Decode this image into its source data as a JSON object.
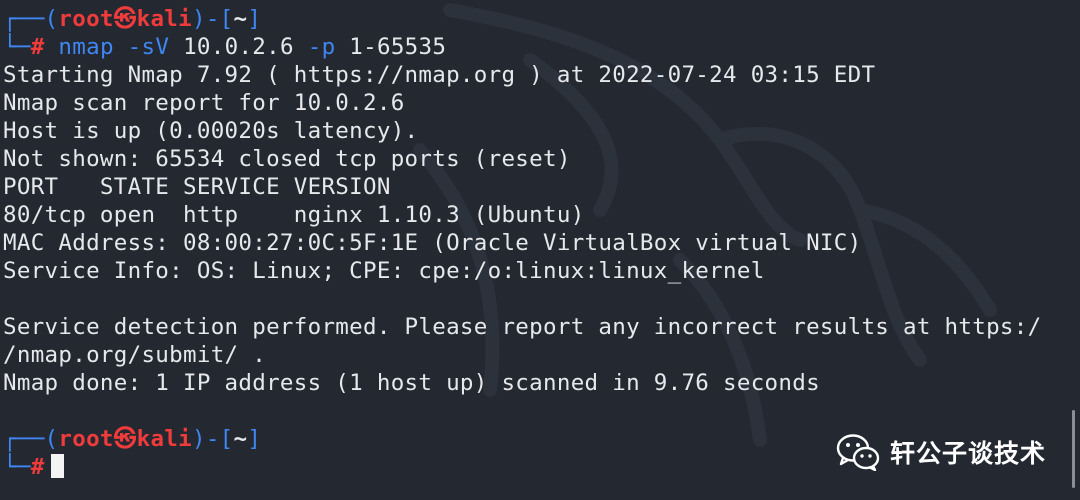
{
  "prompt": {
    "open": "┌──(",
    "user": "root",
    "skull": "㉿",
    "host": "kali",
    "mid": ")-[",
    "dir": "~",
    "close": "]",
    "second": "└─",
    "hash": "#"
  },
  "command": {
    "name": "nmap",
    "flag1": "-sV",
    "target": "10.0.2.6",
    "flag2": "-p",
    "ports": "1-65535"
  },
  "output": [
    "Starting Nmap 7.92 ( https://nmap.org ) at 2022-07-24 03:15 EDT",
    "Nmap scan report for 10.0.2.6",
    "Host is up (0.00020s latency).",
    "Not shown: 65534 closed tcp ports (reset)",
    "PORT   STATE SERVICE VERSION",
    "80/tcp open  http    nginx 1.10.3 (Ubuntu)",
    "MAC Address: 08:00:27:0C:5F:1E (Oracle VirtualBox virtual NIC)",
    "Service Info: OS: Linux; CPE: cpe:/o:linux:linux_kernel",
    "",
    "Service detection performed. Please report any incorrect results at https:/",
    "/nmap.org/submit/ .",
    "Nmap done: 1 IP address (1 host up) scanned in 9.76 seconds",
    ""
  ],
  "watermark": {
    "text": "轩公子谈技术",
    "icon": "wechat-icon"
  },
  "colors": {
    "background": "#232831",
    "prompt_red": "#ee3b3b",
    "bracket_blue": "#3f86f2",
    "text": "#e6e8eb"
  }
}
